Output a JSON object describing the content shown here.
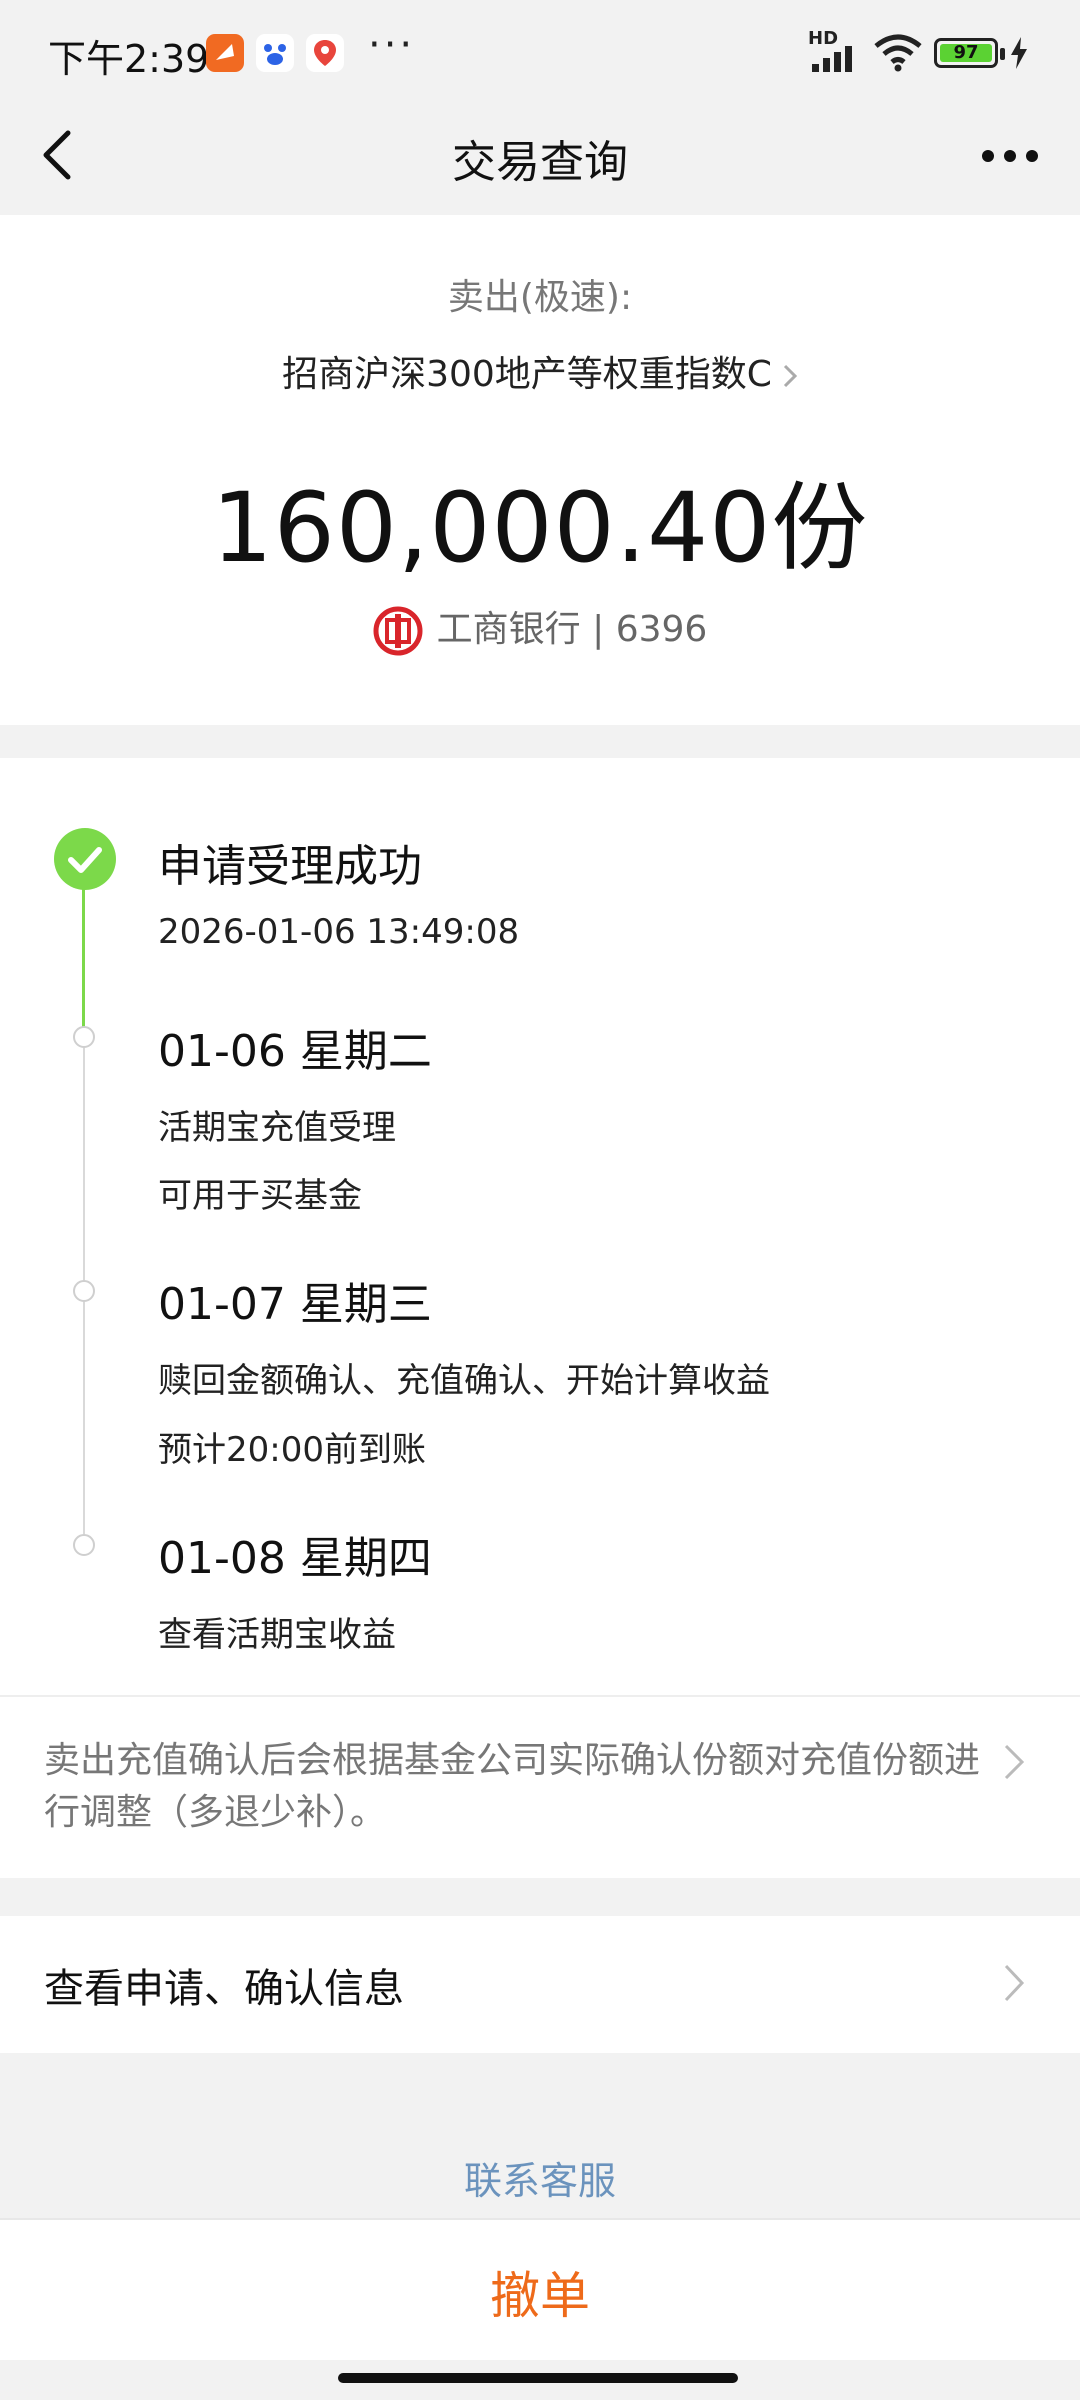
{
  "status": {
    "time": "下午2:39",
    "battery": "97",
    "dots": "···",
    "network": "HD"
  },
  "nav": {
    "title": "交易查询"
  },
  "header": {
    "sell_type": "卖出(极速):",
    "fund_name": "招商沪深300地产等权重指数C",
    "amount": "160,000.40份",
    "bank": "工商银行 | 6396"
  },
  "timeline": [
    {
      "title": "申请受理成功",
      "lines": [
        "2026-01-06 13:49:08"
      ],
      "done": true
    },
    {
      "title": "01-06 星期二",
      "lines": [
        "活期宝充值受理",
        "可用于买基金"
      ],
      "done": false
    },
    {
      "title": "01-07 星期三",
      "lines": [
        "赎回金额确认、充值确认、开始计算收益",
        "预计20:00前到账"
      ],
      "done": false
    },
    {
      "title": "01-08 星期四",
      "lines": [
        "查看活期宝收益"
      ],
      "done": false
    }
  ],
  "note": "卖出充值确认后会根据基金公司实际确认份额对充值份额进行调整（多退少补）。",
  "info_row": {
    "label": "查看申请、确认信息"
  },
  "contact": "联系客服",
  "cancel": "撤单",
  "colors": {
    "accent_green": "#7cd94a",
    "cancel_orange": "#ee6a1a",
    "link_blue": "#6b93bd",
    "bank_red": "#d9252b"
  }
}
